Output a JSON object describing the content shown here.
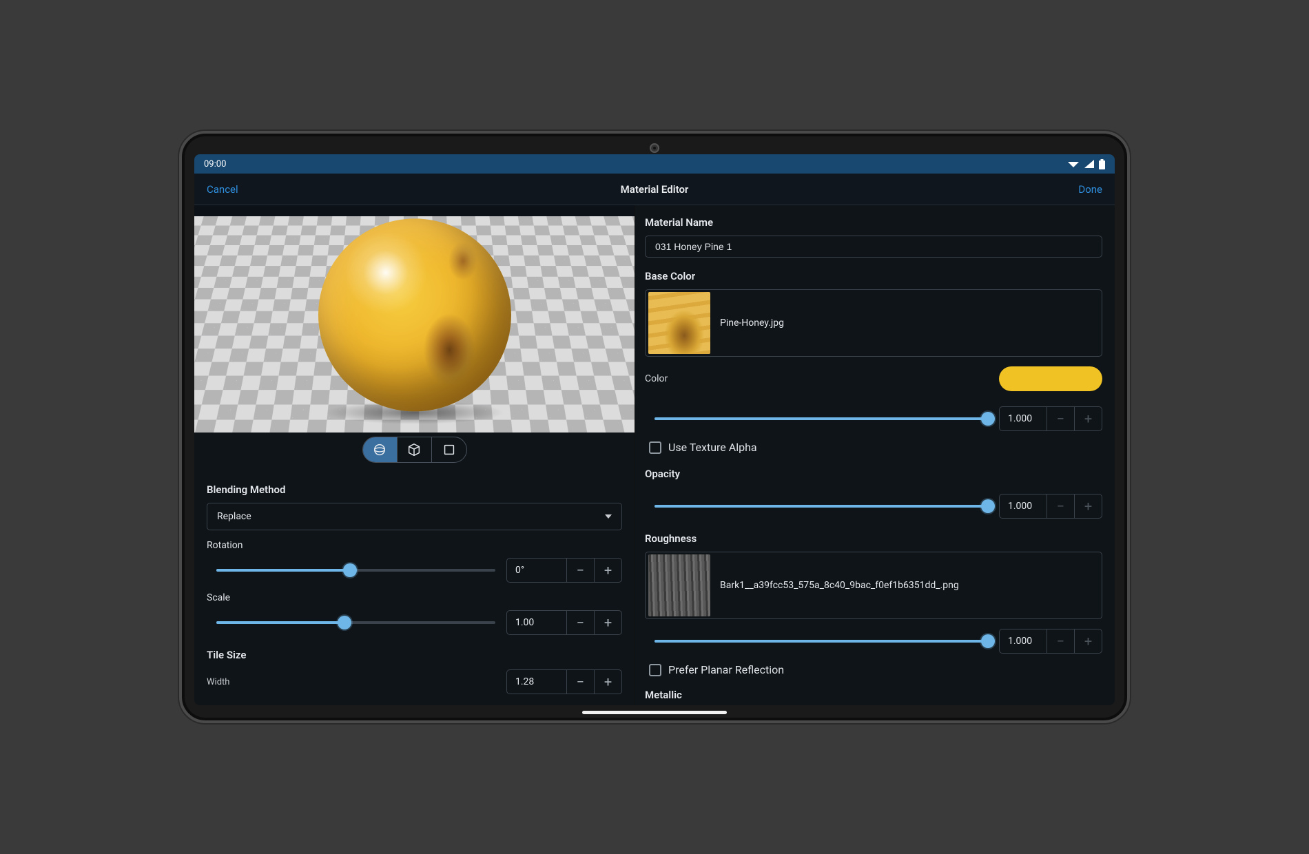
{
  "status_bar": {
    "time": "09:00"
  },
  "header": {
    "cancel": "Cancel",
    "title": "Material Editor",
    "done": "Done"
  },
  "left": {
    "blending_method_label": "Blending Method",
    "blending_method_value": "Replace",
    "rotation_label": "Rotation",
    "rotation_value": "0°",
    "rotation_pct": 48,
    "scale_label": "Scale",
    "scale_value": "1.00",
    "scale_pct": 46,
    "tile_size_label": "Tile Size",
    "width_label": "Width",
    "width_value": "1.28"
  },
  "right": {
    "material_name_label": "Material Name",
    "material_name_value": "031 Honey Pine 1",
    "base_color_label": "Base Color",
    "base_color_filename": "Pine-Honey.jpg",
    "color_label": "Color",
    "color_hex": "#f0c224",
    "color_mix_value": "1.000",
    "color_mix_pct": 100,
    "use_texture_alpha_label": "Use Texture Alpha",
    "use_texture_alpha_checked": false,
    "opacity_label": "Opacity",
    "opacity_value": "1.000",
    "opacity_pct": 100,
    "roughness_label": "Roughness",
    "roughness_filename": "Bark1__a39fcc53_575a_8c40_9bac_f0ef1b6351dd_.png",
    "roughness_value": "1.000",
    "roughness_pct": 100,
    "prefer_planar_label": "Prefer Planar Reflection",
    "prefer_planar_checked": false,
    "metallic_label": "Metallic"
  }
}
